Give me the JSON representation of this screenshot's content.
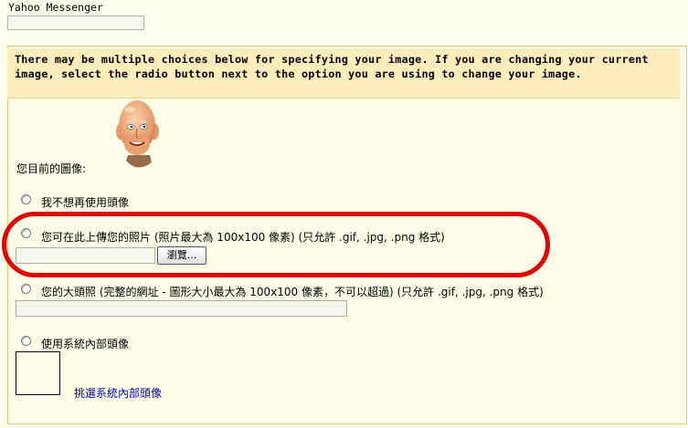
{
  "messenger": {
    "label": "Yahoo Messenger",
    "value": ""
  },
  "notice": "There may be multiple choices below for specifying your image. If you are changing your current image, select the radio button next to the option you are using to change your image.",
  "current_image_label": "您目前的圖像:",
  "options": {
    "no_avatar": "我不想再使用頭像",
    "upload": "您可在此上傳您的照片 (照片最大為 100x100 像素) (只允許 .gif, .jpg, .png 格式)",
    "browse_label": "瀏覽...",
    "big_photo": "您的大頭照 (完整的網址 - 圖形大小最大為 100x100 像素，不可以超過) (只允許 .gif, .jpg, .png 格式)",
    "system_avatar": "使用系統內部頭像",
    "choose_system_link": "挑選系統內部頭像"
  },
  "colors": {
    "highlight": "#e40000",
    "link": "#0000cc",
    "notice_bg": "#ffeebb"
  }
}
